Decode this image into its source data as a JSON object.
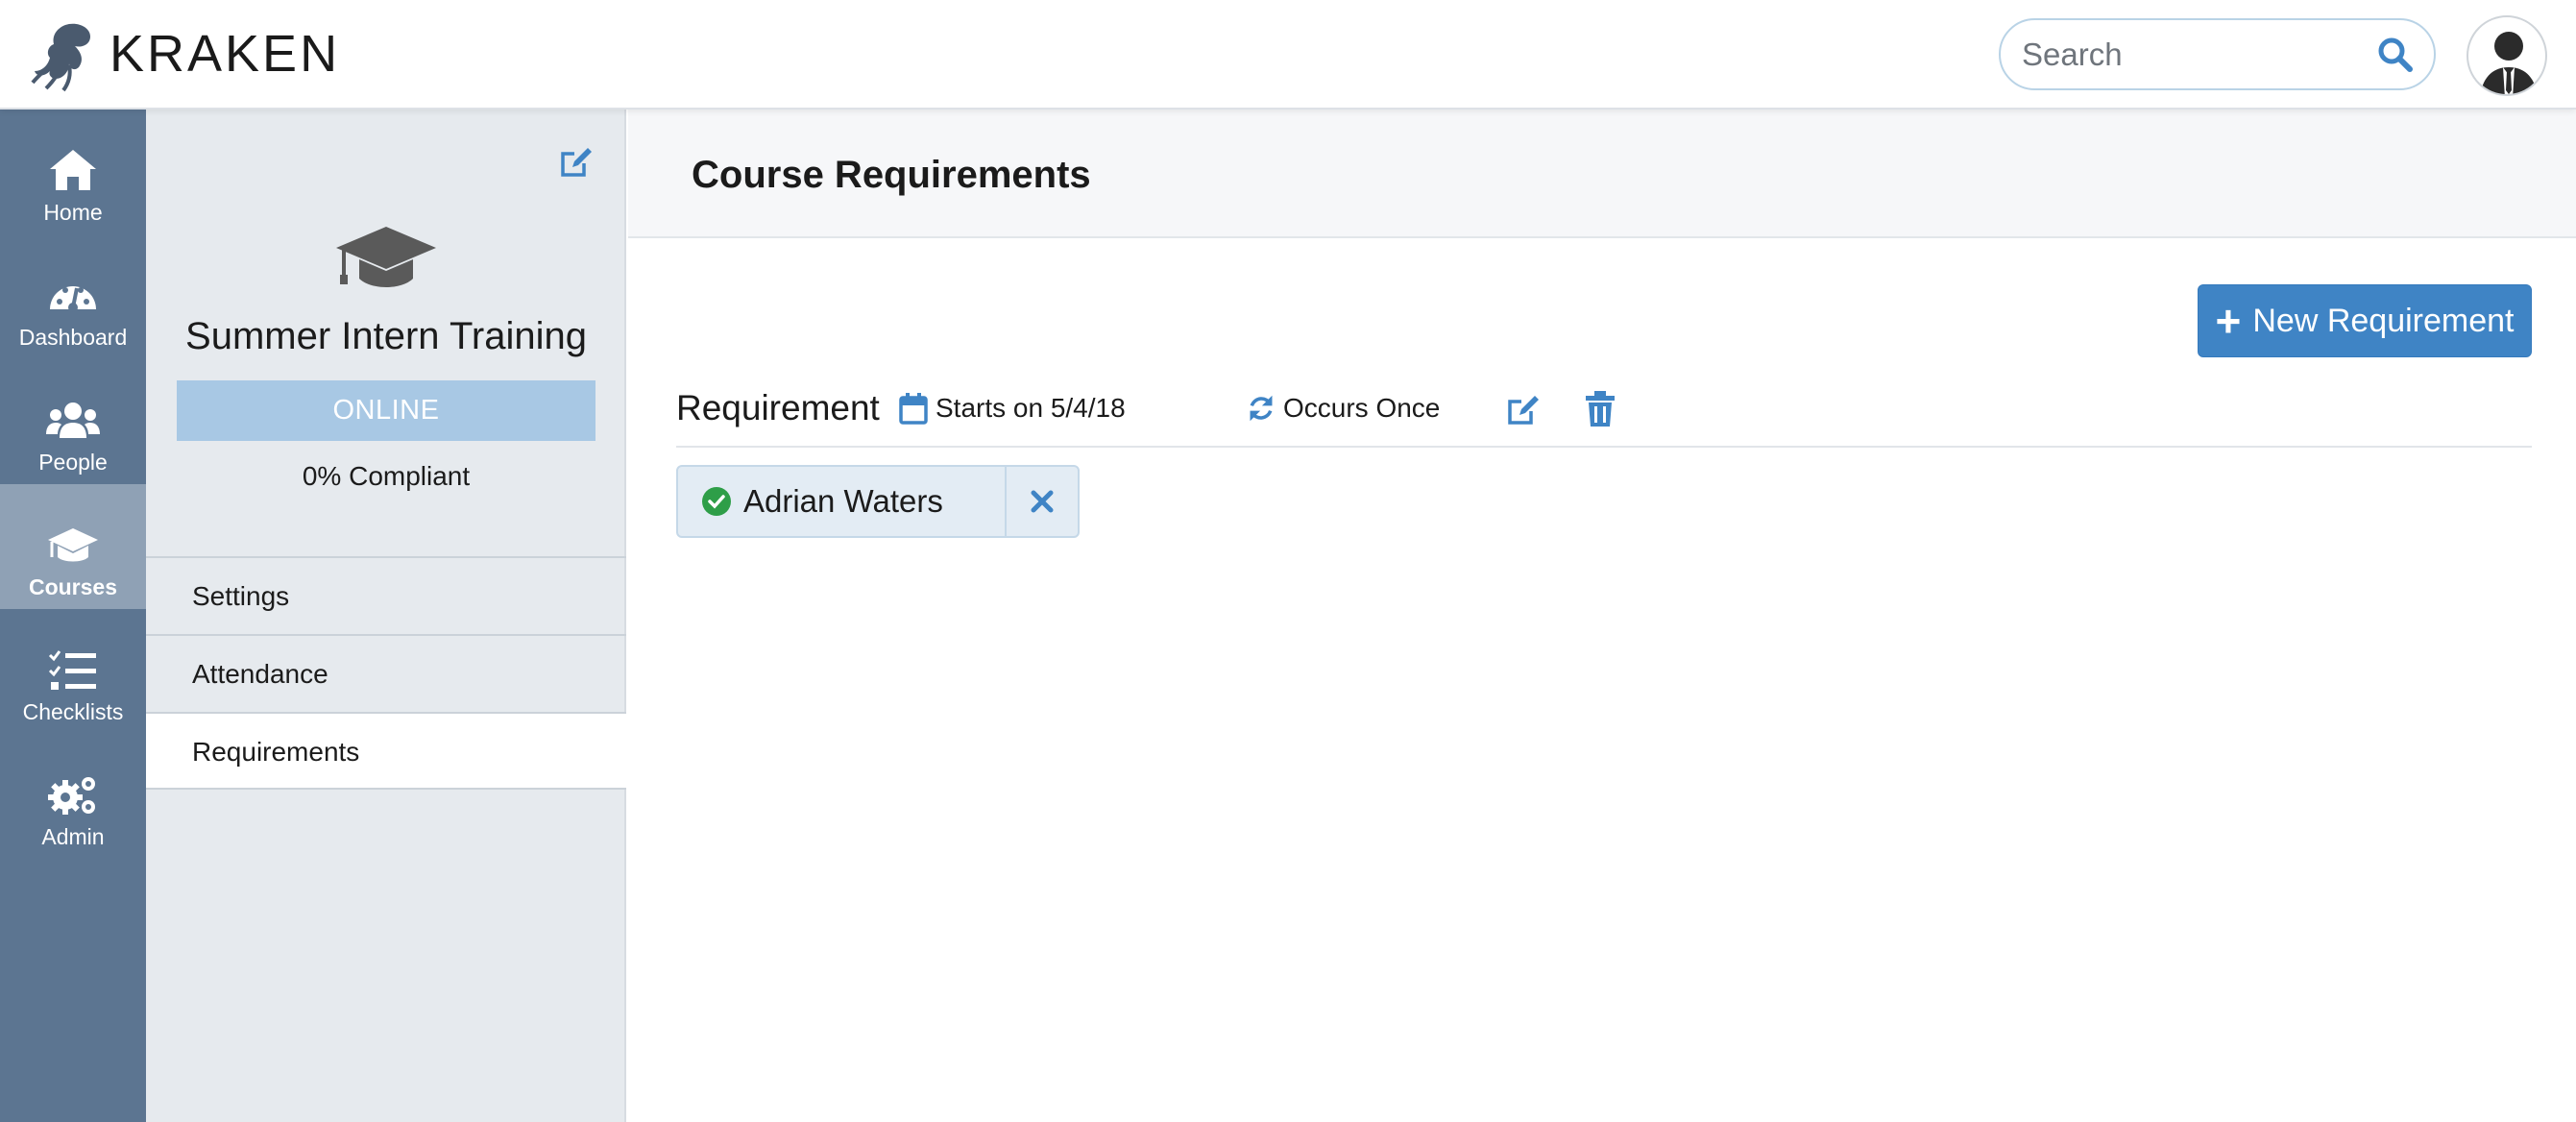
{
  "brand": {
    "name": "KRAKEN"
  },
  "search": {
    "placeholder": "Search"
  },
  "nav": {
    "items": [
      {
        "label": "Home",
        "icon": "home-icon"
      },
      {
        "label": "Dashboard",
        "icon": "dashboard-icon"
      },
      {
        "label": "People",
        "icon": "people-icon"
      },
      {
        "label": "Courses",
        "icon": "graduation-cap-icon",
        "active": true
      },
      {
        "label": "Checklists",
        "icon": "checklist-icon"
      },
      {
        "label": "Admin",
        "icon": "gears-icon"
      }
    ]
  },
  "course": {
    "title": "Summer Intern Training",
    "status": "ONLINE",
    "compliance": "0% Compliant",
    "menu": [
      "Settings",
      "Attendance",
      "Requirements"
    ],
    "active_menu": "Requirements"
  },
  "page": {
    "title": "Course Requirements",
    "new_button": "New Requirement"
  },
  "requirement": {
    "label": "Requirement",
    "starts": "Starts on 5/4/18",
    "occurs": "Occurs Once",
    "assignees": [
      "Adrian Waters"
    ]
  },
  "colors": {
    "nav_bg": "#5c7591",
    "nav_active": "#8fa1b5",
    "accent": "#3f84c5",
    "status_badge": "#a8c8e4",
    "success": "#2e9e48"
  }
}
